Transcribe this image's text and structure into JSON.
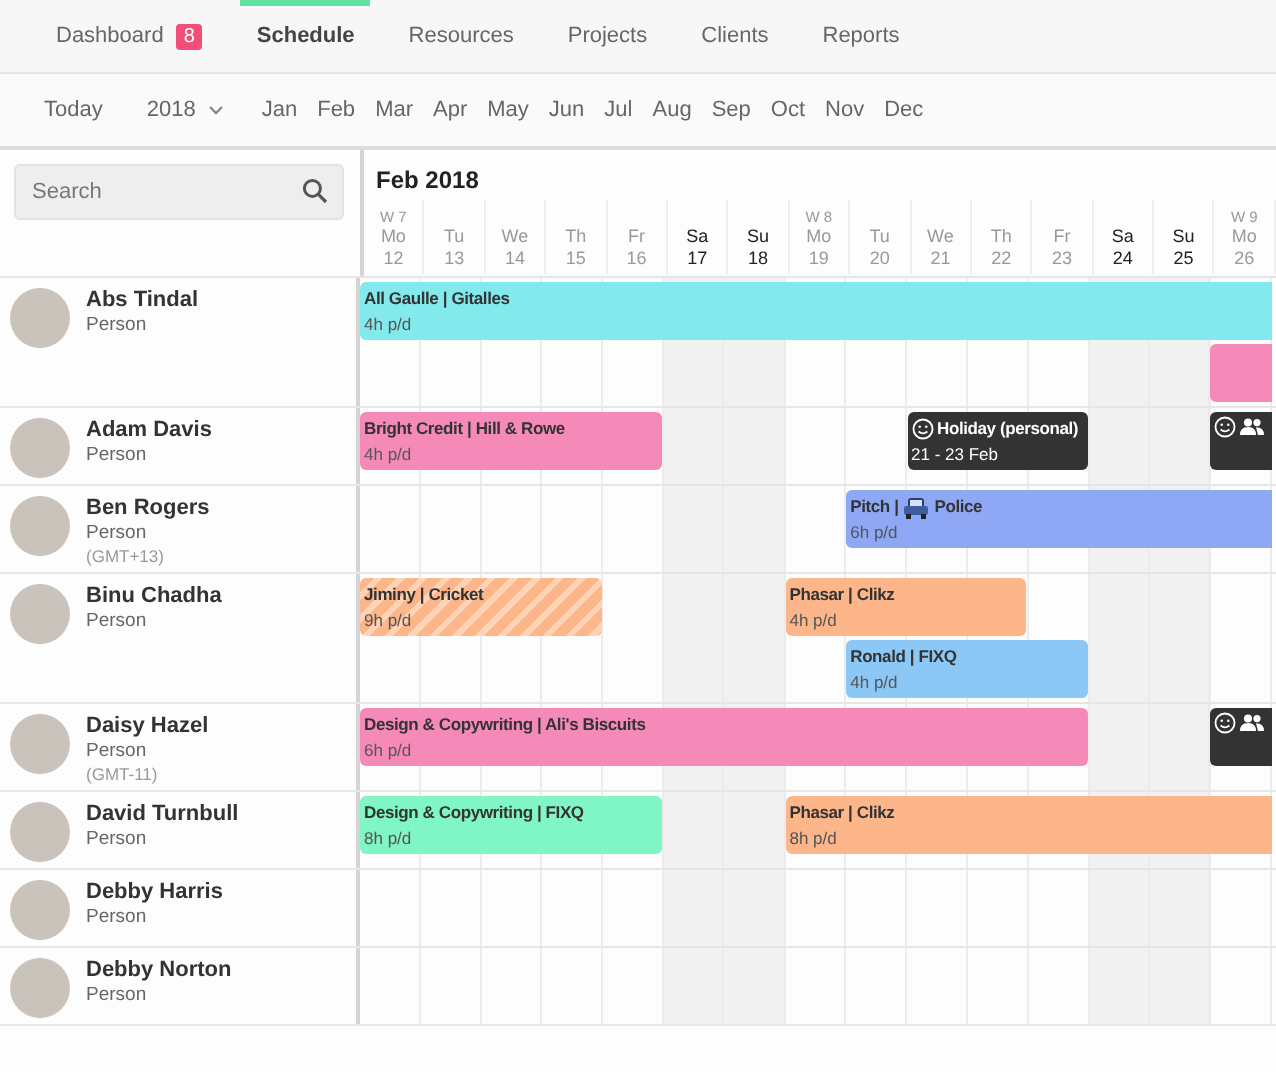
{
  "nav": {
    "tabs": [
      {
        "label": "Dashboard",
        "badge": "8",
        "selected": false
      },
      {
        "label": "Schedule",
        "selected": true
      },
      {
        "label": "Resources",
        "selected": false
      },
      {
        "label": "Projects",
        "selected": false
      },
      {
        "label": "Clients",
        "selected": false
      },
      {
        "label": "Reports",
        "selected": false
      }
    ]
  },
  "period_bar": {
    "today": "Today",
    "year": "2018",
    "months": [
      "Jan",
      "Feb",
      "Mar",
      "Apr",
      "May",
      "Jun",
      "Jul",
      "Aug",
      "Sep",
      "Oct",
      "Nov",
      "Dec"
    ]
  },
  "search": {
    "placeholder": "Search"
  },
  "calendar": {
    "month": "Feb 2018",
    "days": [
      {
        "week": "W 7",
        "name": "Mo",
        "date": "12",
        "weekend": false
      },
      {
        "name": "Tu",
        "date": "13",
        "weekend": false
      },
      {
        "name": "We",
        "date": "14",
        "weekend": false
      },
      {
        "name": "Th",
        "date": "15",
        "weekend": false
      },
      {
        "name": "Fr",
        "date": "16",
        "weekend": false
      },
      {
        "name": "Sa",
        "date": "17",
        "weekend": true
      },
      {
        "name": "Su",
        "date": "18",
        "weekend": true
      },
      {
        "week": "W 8",
        "name": "Mo",
        "date": "19",
        "weekend": false
      },
      {
        "name": "Tu",
        "date": "20",
        "weekend": false
      },
      {
        "name": "We",
        "date": "21",
        "weekend": false
      },
      {
        "name": "Th",
        "date": "22",
        "weekend": false
      },
      {
        "name": "Fr",
        "date": "23",
        "weekend": false
      },
      {
        "name": "Sa",
        "date": "24",
        "weekend": true
      },
      {
        "name": "Su",
        "date": "25",
        "weekend": true
      },
      {
        "week": "W 9",
        "name": "Mo",
        "date": "26",
        "weekend": false
      }
    ]
  },
  "people": [
    {
      "name": "Abs Tindal",
      "role": "Person",
      "bookings": [
        {
          "kind": "project",
          "title": "All Gaulle | Gitalles",
          "hours": "4h p/d",
          "color": "#82e9ec"
        },
        {
          "kind": "project",
          "color": "#f58ab8"
        }
      ]
    },
    {
      "name": "Adam Davis",
      "role": "Person",
      "bookings": [
        {
          "kind": "project",
          "title": "Bright Credit | Hill & Rowe",
          "hours": "4h p/d",
          "color": "#f58ab8"
        },
        {
          "kind": "holiday",
          "title": "Holiday (personal)",
          "hours": "21 - 23 Feb",
          "color": "#333333"
        },
        {
          "kind": "holiday",
          "group": true,
          "color": "#333333"
        }
      ]
    },
    {
      "name": "Ben Rogers",
      "role": "Person",
      "timezone": "(GMT+13)",
      "bookings": [
        {
          "kind": "project",
          "title": "Pitch |",
          "title_after_car": "Police",
          "hours": "6h p/d",
          "color": "#8fa8f5"
        }
      ]
    },
    {
      "name": "Binu Chadha",
      "role": "Person",
      "bookings": [
        {
          "kind": "tentative",
          "title": "Jiminy | Cricket",
          "hours": "9h p/d",
          "color": "#fdb58a"
        },
        {
          "kind": "project",
          "title": "Phasar | Clikz",
          "hours": "4h p/d",
          "color": "#fdb58a"
        },
        {
          "kind": "project",
          "title": "Ronald | FIXQ",
          "hours": "4h p/d",
          "color": "#8cc8f5"
        }
      ]
    },
    {
      "name": "Daisy Hazel",
      "role": "Person",
      "timezone": "(GMT-11)",
      "bookings": [
        {
          "kind": "project",
          "title": "Design & Copywriting | Ali's Biscuits",
          "hours": "6h p/d",
          "color": "#f58ab8"
        },
        {
          "kind": "holiday",
          "group": true,
          "color": "#333333"
        }
      ]
    },
    {
      "name": "David Turnbull",
      "role": "Person",
      "bookings": [
        {
          "kind": "project",
          "title": "Design & Copywriting | FIXQ",
          "hours": "8h p/d",
          "color": "#80f5c5"
        },
        {
          "kind": "project",
          "title": "Phasar | Clikz",
          "hours": "8h p/d",
          "color": "#fdb58a"
        }
      ]
    },
    {
      "name": "Debby Harris",
      "role": "Person"
    },
    {
      "name": "Debby Norton",
      "role": "Person"
    }
  ]
}
